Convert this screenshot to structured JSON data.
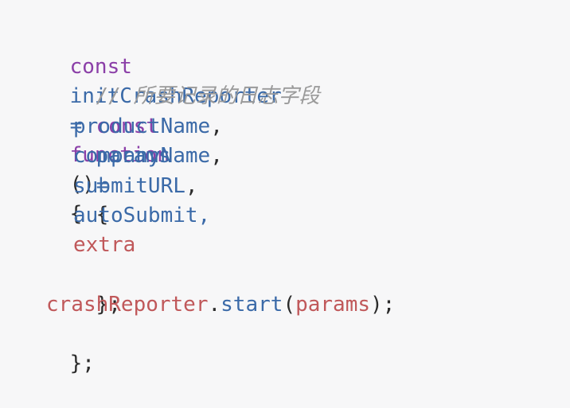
{
  "code": {
    "line1": {
      "kw_const": "const",
      "name": "initCrashReporter",
      "assign": "=",
      "kw_function": "function",
      "parens": "()",
      "brace_open": "{"
    },
    "line2": {
      "comment": "// 所要记录的日志字段"
    },
    "line3": {
      "kw_const": "const",
      "name": "params",
      "assign": "=",
      "brace_open": "{"
    },
    "params": [
      {
        "name": "productName",
        "sep": ","
      },
      {
        "name": "companyName",
        "sep": ","
      },
      {
        "name": "submitURL",
        "sep": ","
      },
      {
        "name": "autoSubmit",
        "sep": ","
      },
      {
        "name": "extra",
        "sep": ""
      }
    ],
    "line9": {
      "close": "};"
    },
    "line10": {
      "object": "crashReporter",
      "dot": ".",
      "method": "start",
      "paren_open": "(",
      "arg": "params",
      "paren_close": ");"
    },
    "line11": {
      "close": "};"
    }
  },
  "colors": {
    "background": "#f7f7f8",
    "keyword": "#8b3fa8",
    "identifier": "#3b6aa8",
    "variable": "#c0585a",
    "comment": "#9a9a9a",
    "text": "#2b2b2b"
  }
}
